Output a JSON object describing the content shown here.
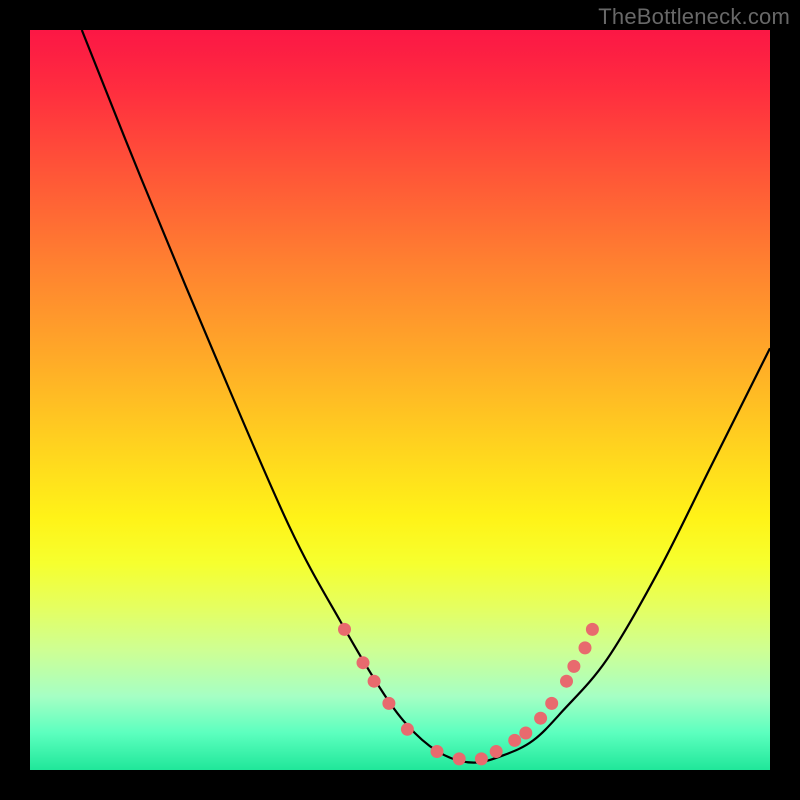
{
  "watermark": "TheBottleneck.com",
  "colors": {
    "background": "#000000",
    "gradient_top": "#fb1745",
    "gradient_bottom": "#20e79a",
    "curve": "#000000",
    "dots": "#e86a6e"
  },
  "chart_data": {
    "type": "line",
    "title": "",
    "xlabel": "",
    "ylabel": "",
    "xlim": [
      0,
      100
    ],
    "ylim": [
      0,
      100
    ],
    "series": [
      {
        "name": "bottleneck-curve",
        "x": [
          7,
          15,
          25,
          35,
          42,
          48,
          52,
          56,
          60,
          64,
          68,
          72,
          78,
          85,
          92,
          100
        ],
        "y": [
          100,
          80,
          56,
          33,
          20,
          10,
          5,
          2,
          1,
          2,
          4,
          8,
          15,
          27,
          41,
          57
        ]
      }
    ],
    "markers": {
      "name": "highlight-dots",
      "x": [
        42.5,
        45,
        46.5,
        48.5,
        51,
        55,
        58,
        61,
        63,
        65.5,
        67,
        69,
        70.5,
        72.5,
        73.5,
        75,
        76
      ],
      "y": [
        19,
        14.5,
        12,
        9,
        5.5,
        2.5,
        1.5,
        1.5,
        2.5,
        4,
        5,
        7,
        9,
        12,
        14,
        16.5,
        19
      ]
    }
  }
}
